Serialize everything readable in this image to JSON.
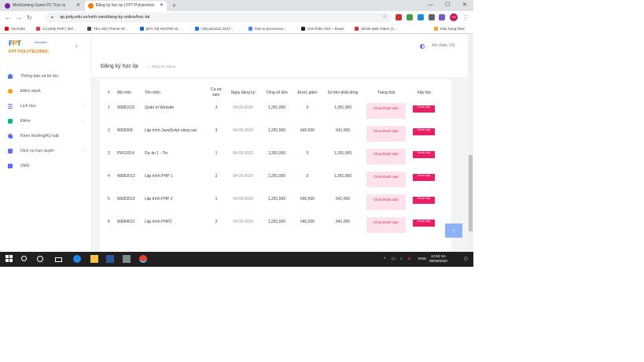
{
  "browser": {
    "tabs": [
      {
        "title": "MiniGaming Game PC Trực tu",
        "favicon_color": "#7b1fa2"
      },
      {
        "title": "Đăng ký học lại | FPT Polytechnic",
        "favicon_color": "#f57c00"
      }
    ],
    "url": "ap.poly.edu.vn/sinh-vien/dang-ky-online/hoc-lai",
    "profile_initials": "VG"
  },
  "bookmarks": [
    {
      "label": "YouTube",
      "color": "#ff0000"
    },
    {
      "label": "Cú pháp PHP | 287...",
      "color": "#e53935"
    },
    {
      "label": "Thư viện Theme Ht...",
      "color": "#5d4037"
    },
    {
      "label": "[BÀI 23] HƯỚNG D...",
      "color": "#1565c0"
    },
    {
      "label": "(46) pt12311 2017...",
      "color": "#1877f2"
    },
    {
      "label": "how to pronounce...",
      "color": "#4285f4"
    },
    {
      "label": "Giới thiệu JSX – React",
      "color": "#222222"
    },
    {
      "label": "JSON Web Token (J...",
      "color": "#d32f2f"
    },
    {
      "label": "Dấu trang khác",
      "color": "#f9a825"
    }
  ],
  "sidebar": {
    "logo": {
      "main": "FPT",
      "education": "Education",
      "sub": "FPT POLYTECHNIC"
    },
    "items": [
      {
        "label": "Thông báo và tin tức",
        "icon": "bell-icon",
        "color": "#5b6ef5",
        "has_children": false
      },
      {
        "label": "Điểm danh",
        "icon": "user-check-icon",
        "color": "#f59e0b",
        "has_children": false
      },
      {
        "label": "Lịch học",
        "icon": "list-icon",
        "color": "#5b6ef5",
        "has_children": true
      },
      {
        "label": "Điểm",
        "icon": "chart-icon",
        "color": "#10b981",
        "has_children": true
      },
      {
        "label": "Khen thưởng/Kỷ luật",
        "icon": "heart-icon",
        "color": "#5b6ef5",
        "has_children": false
      },
      {
        "label": "Dịch vụ trực tuyến",
        "icon": "grid-icon",
        "color": "#5b6ef5",
        "has_children": true
      },
      {
        "label": "SMS",
        "icon": "message-icon",
        "color": "#5b6ef5",
        "has_children": false
      }
    ]
  },
  "header": {
    "greeting": "Xin chào, VG",
    "page_title": "Đăng ký học lại",
    "breadcrumb": "Đăng ký online"
  },
  "table": {
    "headers": [
      "#",
      "Mã môn",
      "Tên môn",
      "Ca dự kiến",
      "Ngày đăng ký",
      "Tổng số tiền",
      "Được giảm",
      "Số tiền phải đóng",
      "Trạng thái",
      "Xếp lớp"
    ],
    "rows": [
      {
        "no": "1",
        "code": "WEB1022",
        "name": "Quản trị Website",
        "shift": "3",
        "date": "04-09-2020",
        "total": "1,281,000",
        "discount": "0",
        "payable": "1,281,000",
        "status": "Chưa thanh toán",
        "action": "Chưa xếp"
      },
      {
        "no": "2",
        "code": "WEB206",
        "name": "Lập trình JavaScript nâng cao",
        "shift": "3",
        "date": "04-09-2020",
        "total": "1,281,500",
        "discount": "640,500",
        "payable": "641,000",
        "status": "Chưa thanh toán",
        "action": "Chưa xếp"
      },
      {
        "no": "3",
        "code": "PRO1014",
        "name": "Dự án 1 - Tin",
        "shift": "1",
        "date": "04-09-2020",
        "total": "1,281,000",
        "discount": "0",
        "payable": "1,281,000",
        "status": "Chưa thanh toán",
        "action": "Chưa xếp"
      },
      {
        "no": "4",
        "code": "WEB2013",
        "name": "Lập trình PHP 1",
        "shift": "2",
        "date": "04-09-2020",
        "total": "1,281,000",
        "discount": "0",
        "payable": "1,281,000",
        "status": "Chưa thanh toán",
        "action": "Chưa xếp"
      },
      {
        "no": "5",
        "code": "WEB3013",
        "name": "Lập trình PHP 2",
        "shift": "1",
        "date": "04-09-2020",
        "total": "1,281,500",
        "discount": "640,500",
        "payable": "641,000",
        "status": "Chưa thanh toán",
        "action": "Chưa xếp"
      },
      {
        "no": "6",
        "code": "WEB4012",
        "name": "Lập trình PHP3",
        "shift": "2",
        "date": "04-09-2020",
        "total": "1,281,500",
        "discount": "640,500",
        "payable": "641,000",
        "status": "Chưa thanh toán",
        "action": "Chưa xếp"
      }
    ]
  },
  "taskbar": {
    "language": "ENG",
    "time": "12:53 SA",
    "date": "08/09/2020"
  }
}
